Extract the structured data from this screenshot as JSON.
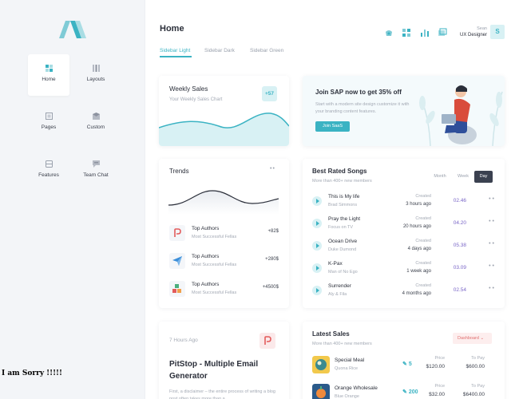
{
  "sidebar": {
    "items": [
      {
        "label": "Home",
        "icon": "dashboard-icon"
      },
      {
        "label": "Layouts",
        "icon": "layouts-icon"
      },
      {
        "label": "Pages",
        "icon": "pages-icon"
      },
      {
        "label": "Custom",
        "icon": "custom-icon"
      },
      {
        "label": "Features",
        "icon": "features-icon"
      },
      {
        "label": "Team Chat",
        "icon": "chat-icon"
      }
    ]
  },
  "header": {
    "title": "Home",
    "tabs": [
      "Sidebar Light",
      "Sidebar Dark",
      "Sidebar Green"
    ],
    "user_name": "Sean",
    "user_role": "UX Designer",
    "avatar_letter": "S"
  },
  "weekly_sales": {
    "title": "Weekly Sales",
    "subtitle": "Your Weekly Sales Chart",
    "badge": "+57"
  },
  "promo": {
    "title": "Join SAP now to get 35% off",
    "text": "Start with a modern site design customize it with your branding content features.",
    "button": "Join SaaS"
  },
  "trends": {
    "title": "Trends",
    "authors": [
      {
        "name": "Top Authors",
        "sub": "Most Successful Fellas",
        "value": "+82$"
      },
      {
        "name": "Top Authors",
        "sub": "Most Successful Fellas",
        "value": "+280$"
      },
      {
        "name": "Top Authors",
        "sub": "Most Successful Fellas",
        "value": "+4500$"
      }
    ]
  },
  "songs": {
    "title": "Best Rated Songs",
    "subtitle": "More than 400+ new members",
    "periods": [
      "Month",
      "Week",
      "Day"
    ],
    "created_label": "Created",
    "rows": [
      {
        "name": "This is My life",
        "artist": "Brad Simmons",
        "created": "3 hours ago",
        "duration": "02.46"
      },
      {
        "name": "Pray the Light",
        "artist": "Focus on TV",
        "created": "20 hours ago",
        "duration": "04.20"
      },
      {
        "name": "Ocean Drive",
        "artist": "Duke Dumond",
        "created": "4 days ago",
        "duration": "05.38"
      },
      {
        "name": "K-Pax",
        "artist": "Man of No Ego",
        "created": "1 week ago",
        "duration": "03.09"
      },
      {
        "name": "Surrender",
        "artist": "Aly & Fila",
        "created": "4 months ago",
        "duration": "02.54"
      }
    ]
  },
  "article": {
    "time": "7 Hours Ago",
    "title": "PitStop - Multiple Email Generator",
    "text": "First, a disclaimer – the entire process of writing a blog post often takes more than a"
  },
  "sales": {
    "title": "Latest Sales",
    "subtitle": "More than 400+ new members",
    "button": "Dashboard",
    "price_label": "Price",
    "topay_label": "To Pay",
    "rows": [
      {
        "name": "Special Meal",
        "brand": "Quona Rice",
        "qty": "5",
        "price": "$120.00",
        "to_pay": "$600.00"
      },
      {
        "name": "Orange Wholesale",
        "brand": "Blue Orange",
        "qty": "200",
        "price": "$32.00",
        "to_pay": "$6400.00"
      }
    ]
  },
  "overlay": "I am Sorry !!!!!",
  "colors": {
    "accent": "#3bb3c3",
    "duration": "#7a66c7",
    "dark_button": "#3b4150"
  }
}
